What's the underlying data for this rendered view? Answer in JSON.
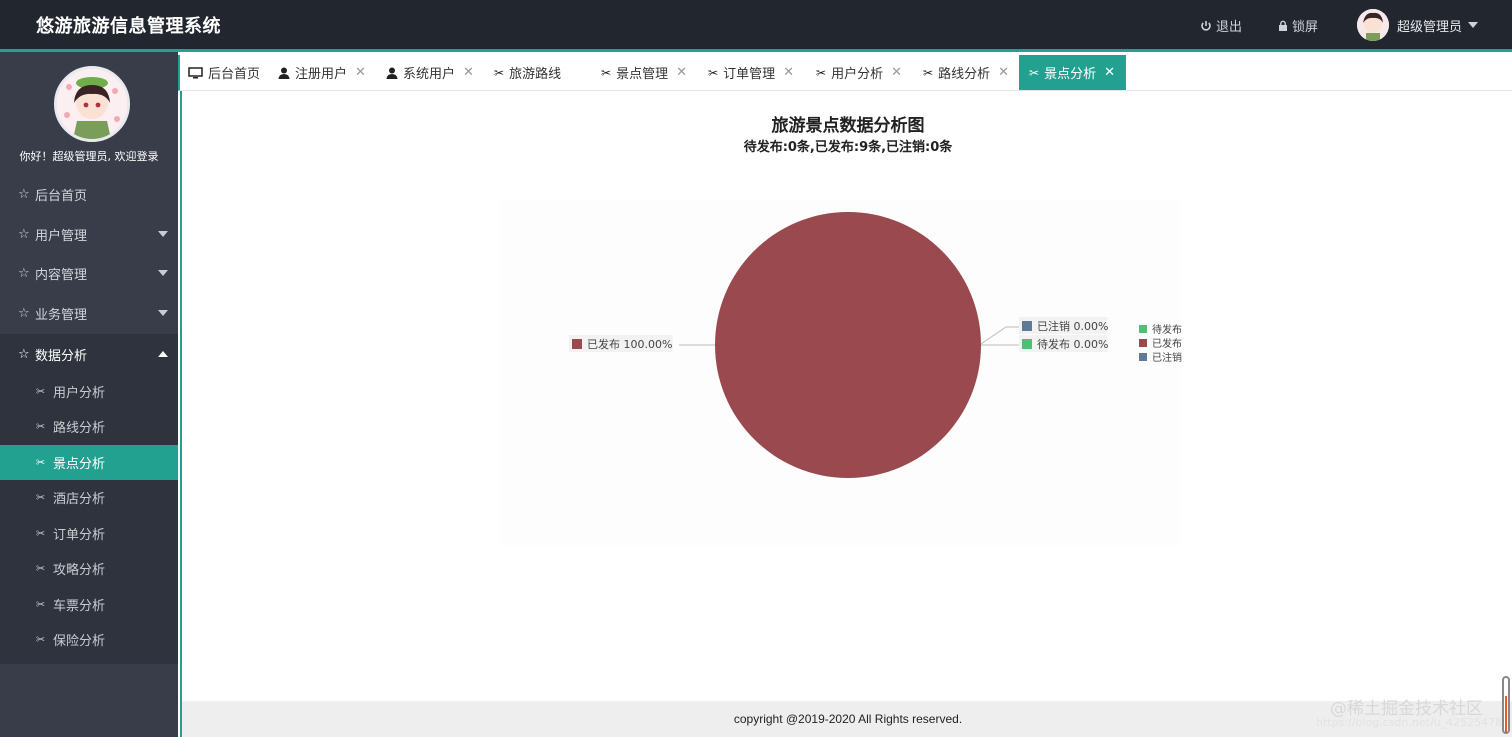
{
  "app": {
    "title": "悠游旅游信息管理系统"
  },
  "header": {
    "logout_label": "退出",
    "lock_label": "锁屏",
    "user_name": "超级管理员",
    "logout_icon": "power-icon",
    "lock_icon": "lock-icon"
  },
  "sidebar": {
    "welcome": "你好！超级管理员, 欢迎登录",
    "menu": [
      {
        "label": "后台首页"
      },
      {
        "label": "用户管理"
      },
      {
        "label": "内容管理"
      },
      {
        "label": "业务管理"
      },
      {
        "label": "数据分析"
      }
    ],
    "submenu": [
      {
        "label": "用户分析"
      },
      {
        "label": "路线分析"
      },
      {
        "label": "景点分析"
      },
      {
        "label": "酒店分析"
      },
      {
        "label": "订单分析"
      },
      {
        "label": "攻略分析"
      },
      {
        "label": "车票分析"
      },
      {
        "label": "保险分析"
      }
    ]
  },
  "tabs": [
    {
      "label": "后台首页",
      "icon": "monitor-icon"
    },
    {
      "label": "注册用户",
      "icon": "user-icon"
    },
    {
      "label": "系统用户",
      "icon": "user-icon"
    },
    {
      "label": "旅游路线",
      "icon": "tools-icon"
    },
    {
      "label": "景点管理",
      "icon": "tools-icon"
    },
    {
      "label": "订单管理",
      "icon": "tools-icon"
    },
    {
      "label": "用户分析",
      "icon": "tools-icon"
    },
    {
      "label": "路线分析",
      "icon": "tools-icon"
    },
    {
      "label": "景点分析",
      "icon": "tools-icon"
    }
  ],
  "chart_data": {
    "type": "pie",
    "title": "旅游景点数据分析图",
    "subtitle": "待发布:0条,已发布:9条,已注销:0条",
    "slices": [
      {
        "name": "待发布",
        "value": 0,
        "percent_label": "0.00%",
        "color": "#4fbf75"
      },
      {
        "name": "已发布",
        "value": 9,
        "percent_label": "100.00%",
        "color": "#9a4a4e"
      },
      {
        "name": "已注销",
        "value": 0,
        "percent_label": "0.00%",
        "color": "#5e7a94"
      }
    ],
    "legend": [
      "待发布",
      "已发布",
      "已注销"
    ],
    "legend_position": "right"
  },
  "footer": {
    "copyright": "copyright @2019-2020 All Rights reserved.",
    "watermark": "@稀土掘金技术社区",
    "watermark_url": "https://blog.csdn.net/u_42525478"
  },
  "colors": {
    "accent": "#23a190",
    "header_bg": "#22262e",
    "sidebar_bg": "#393d49"
  }
}
